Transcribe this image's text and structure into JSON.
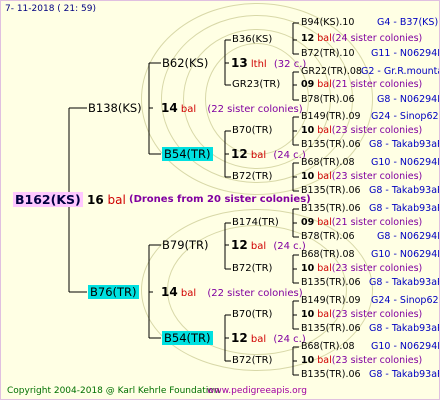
{
  "header": {
    "date": "7- 11-2018 ( 21: 59)"
  },
  "footer": {
    "copyright": "Copyright 2004-2018 @ Karl Kehrle Foundation",
    "url": "www.pedigreeapis.org"
  },
  "root": {
    "name": "B162(KS)",
    "num": "16",
    "bal": "bal",
    "drones": "(Drones from 20 sister colonies)"
  },
  "gen1": [
    {
      "name": "B138(KS)",
      "num": "14",
      "bal": "bal",
      "note": "(22 sister colonies)"
    },
    {
      "name": "B76(TR)",
      "num": "14",
      "bal": "bal",
      "note": "(22 sister colonies)"
    }
  ],
  "gen2": [
    {
      "name": "B62(KS)",
      "num": "13",
      "bal": "lthl",
      "note": "(32 c.)"
    },
    {
      "name": "B54(TR)",
      "num": "12",
      "bal": "bal",
      "note": "(24 c.)"
    },
    {
      "name": "B79(TR)",
      "num": "12",
      "bal": "bal",
      "note": "(24 c.)"
    },
    {
      "name": "B54(TR)",
      "num": "12",
      "bal": "bal",
      "note": "(24 c.)"
    }
  ],
  "gen3": [
    {
      "top": "B36(KS)",
      "bottom": "GR23(TR)"
    },
    {
      "top": "B70(TR)",
      "bottom": "B72(TR)"
    },
    {
      "top": "B174(TR)",
      "bottom": "B72(TR)"
    },
    {
      "top": "B70(TR)",
      "bottom": "B72(TR)"
    }
  ],
  "gen4": [
    {
      "top": "B94(KS).10",
      "top_tag": "G4 - B37(KS)",
      "num": "12",
      "bal": "bal",
      "note": "(24 sister colonies)",
      "bottom": "B72(TR).10",
      "bottom_tag": "G11 - N06294R"
    },
    {
      "top": "GR22(TR).08",
      "top_tag": "G2 - Gr.R.mounta",
      "num": "09",
      "bal": "bal",
      "note": "(21 sister colonies)",
      "bottom": "B78(TR).06",
      "bottom_tag": "G8 - N06294R"
    },
    {
      "top": "B149(TR).09",
      "top_tag": "G24 - Sinop62R",
      "num": "10",
      "bal": "bal",
      "note": "(23 sister colonies)",
      "bottom": "B135(TR).06",
      "bottom_tag": "G8 - Takab93aR"
    },
    {
      "top": "B68(TR).08",
      "top_tag": "G10 - N06294R",
      "num": "10",
      "bal": "bal",
      "note": "(23 sister colonies)",
      "bottom": "B135(TR).06",
      "bottom_tag": "G8 - Takab93aR"
    },
    {
      "top": "B135(TR).06",
      "top_tag": "G8 - Takab93aR",
      "num": "09",
      "bal": "bal",
      "note": "(21 sister colonies)",
      "bottom": "B78(TR).06",
      "bottom_tag": "G8 - N06294R"
    },
    {
      "top": "B68(TR).08",
      "top_tag": "G10 - N06294R",
      "num": "10",
      "bal": "bal",
      "note": "(23 sister colonies)",
      "bottom": "B135(TR).06",
      "bottom_tag": "G8 - Takab93aR"
    },
    {
      "top": "B149(TR).09",
      "top_tag": "G24 - Sinop62R",
      "num": "10",
      "bal": "bal",
      "note": "(23 sister colonies)",
      "bottom": "B135(TR).06",
      "bottom_tag": "G8 - Takab93aR"
    },
    {
      "top": "B68(TR).08",
      "top_tag": "G10 - N06294R",
      "num": "10",
      "bal": "bal",
      "note": "(23 sister colonies)",
      "bottom": "B135(TR).06",
      "bottom_tag": "G8 - Takab93aR"
    }
  ]
}
